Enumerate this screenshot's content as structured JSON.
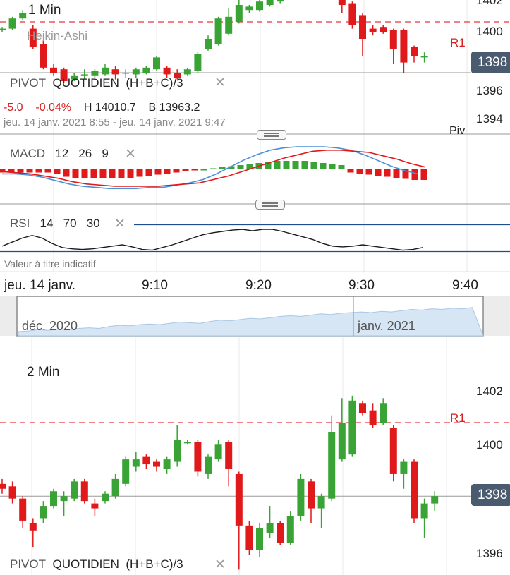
{
  "top_panel": {
    "timeframe": "1 Min",
    "chart_style": "Heikin-Ashi",
    "pivot_label": "PIVOT",
    "pivot_period": "QUOTIDIEN",
    "pivot_formula": "(H+B+C)/3",
    "change_abs": "-5.0",
    "change_pct": "-0.04%",
    "high": "H 14010.7",
    "low": "B 13963.2",
    "date_range": "jeu. 14 janv. 2021 8:55 - jeu. 14 janv. 2021 9:47",
    "r1_label": "R1",
    "pivot_line_label": "Piv",
    "price_tag": "1398",
    "y_ticks": [
      "1402",
      "1400",
      "1398",
      "1396",
      "1394"
    ]
  },
  "macd": {
    "name": "MACD",
    "fast": "12",
    "slow": "26",
    "signal": "9"
  },
  "rsi": {
    "name": "RSI",
    "period": "14",
    "upper": "70",
    "lower": "30"
  },
  "disclaimer": "Valeur à titre indicatif",
  "time_axis": {
    "date": "jeu. 14 janv.",
    "ticks": [
      "9:10",
      "9:20",
      "9:30",
      "9:40"
    ]
  },
  "navigator": {
    "labels": [
      "déc. 2020",
      "janv. 2021"
    ]
  },
  "bottom_panel": {
    "timeframe": "2 Min",
    "pivot_label": "PIVOT",
    "pivot_period": "QUOTIDIEN",
    "pivot_formula": "(H+B+C)/3",
    "r1_label": "R1",
    "price_tag": "1398",
    "y_ticks": [
      "1402",
      "1400",
      "1398",
      "1396"
    ]
  },
  "colors": {
    "up": "#3aa335",
    "down": "#e0191b",
    "r1": "#e8363a",
    "macd_line": "#4a90d9",
    "signal_line": "#e0191b",
    "rsi_line": "#1a1a1a",
    "rsi_bands": "#1f4e8c",
    "price_tag": "#4a5b70"
  },
  "chart_data": [
    {
      "type": "candlestick",
      "title": "1 Min",
      "style": "Heikin-Ashi",
      "ylim": [
        13950,
        14025
      ],
      "y_tick_labels": [
        "1402",
        "1400",
        "1398",
        "1396",
        "1394"
      ],
      "x_tick_labels": [
        "9:10",
        "9:20",
        "9:30",
        "9:40"
      ],
      "r1": 14010,
      "last_price": 13980,
      "candles": [
        {
          "o": 14005,
          "c": 14006,
          "h": 14007,
          "l": 14004
        },
        {
          "o": 14006,
          "c": 14012,
          "h": 14013,
          "l": 14005
        },
        {
          "o": 14012,
          "c": 14015,
          "h": 14017,
          "l": 14011
        },
        {
          "o": 14006,
          "c": 13995,
          "h": 14008,
          "l": 13994
        },
        {
          "o": 13997,
          "c": 13983,
          "h": 13999,
          "l": 13982
        },
        {
          "o": 13983,
          "c": 13980,
          "h": 13985,
          "l": 13978
        },
        {
          "o": 13982,
          "c": 13975,
          "h": 13983,
          "l": 13974
        },
        {
          "o": 13976,
          "c": 13978,
          "h": 13980,
          "l": 13975
        },
        {
          "o": 13978,
          "c": 13979,
          "h": 13982,
          "l": 13976
        },
        {
          "o": 13978,
          "c": 13981,
          "h": 13982,
          "l": 13977
        },
        {
          "o": 13979,
          "c": 13983,
          "h": 13985,
          "l": 13978
        },
        {
          "o": 13982,
          "c": 13979,
          "h": 13984,
          "l": 13976
        },
        {
          "o": 13980,
          "c": 13980,
          "h": 13982,
          "l": 13977
        },
        {
          "o": 13979,
          "c": 13982,
          "h": 13983,
          "l": 13977
        },
        {
          "o": 13980,
          "c": 13983,
          "h": 13984,
          "l": 13979
        },
        {
          "o": 13982,
          "c": 13989,
          "h": 13990,
          "l": 13981
        },
        {
          "o": 13983,
          "c": 13979,
          "h": 13984,
          "l": 13977
        },
        {
          "o": 13980,
          "c": 13977,
          "h": 13982,
          "l": 13976
        },
        {
          "o": 13979,
          "c": 13982,
          "h": 13983,
          "l": 13978
        },
        {
          "o": 13981,
          "c": 13991,
          "h": 13992,
          "l": 13980
        },
        {
          "o": 13994,
          "c": 14000,
          "h": 14002,
          "l": 13993
        },
        {
          "o": 13997,
          "c": 14012,
          "h": 14013,
          "l": 13996
        },
        {
          "o": 14003,
          "c": 14013,
          "h": 14018,
          "l": 14002
        },
        {
          "o": 14010,
          "c": 14020,
          "h": 14024,
          "l": 14009
        },
        {
          "o": 14017,
          "c": 14019,
          "h": 14020,
          "l": 14015
        },
        {
          "o": 14017,
          "c": 14022,
          "h": 14023,
          "l": 14016
        },
        {
          "o": 14020,
          "c": 14023,
          "h": 14026,
          "l": 14019
        },
        {
          "o": 14022,
          "c": 14028,
          "h": 14031,
          "l": 14021
        },
        {
          "o": 14026,
          "c": 14032,
          "h": 14035,
          "l": 14025
        },
        {
          "o": 14030,
          "c": 14030,
          "h": 14031,
          "l": 14028
        },
        {
          "o": 14030,
          "c": 14031,
          "h": 14032,
          "l": 14029
        },
        {
          "o": 14030,
          "c": 14030,
          "h": 14032,
          "l": 14029
        },
        {
          "o": 14030,
          "c": 14027,
          "h": 14032,
          "l": 14026
        },
        {
          "o": 14028,
          "c": 14020,
          "h": 14029,
          "l": 14015
        },
        {
          "o": 14021,
          "c": 14008,
          "h": 14022,
          "l": 14006
        },
        {
          "o": 14014,
          "c": 14000,
          "h": 14015,
          "l": 13990
        },
        {
          "o": 14006,
          "c": 14004,
          "h": 14008,
          "l": 14002
        },
        {
          "o": 14007,
          "c": 14004,
          "h": 14008,
          "l": 14003
        },
        {
          "o": 14005,
          "c": 13994,
          "h": 14006,
          "l": 13985
        },
        {
          "o": 14005,
          "c": 13986,
          "h": 14006,
          "l": 13980
        },
        {
          "o": 13995,
          "c": 13990,
          "h": 13996,
          "l": 13986
        },
        {
          "o": 13989,
          "c": 13990,
          "h": 13992,
          "l": 13986
        }
      ],
      "pivot_legend": "PIVOT QUOTIDIEN (H+B+C)/3"
    },
    {
      "type": "bar",
      "title": "MACD 12 26 9",
      "histogram": [
        -3,
        -3,
        -3,
        -3,
        -3,
        -3,
        -4,
        -7,
        -8,
        -8,
        -8,
        -8,
        -8,
        -8,
        -8,
        -7,
        -6,
        -5,
        -4,
        -3,
        -2,
        -1,
        0,
        1,
        2,
        3,
        4,
        5,
        6,
        7,
        8,
        8,
        8,
        8,
        7,
        6,
        5,
        4,
        -3,
        -4,
        -5,
        -6,
        -7,
        -8,
        -9,
        -10,
        -10,
        -10
      ],
      "macd_line": [
        -4,
        -4,
        -5,
        -7,
        -10,
        -13,
        -15,
        -16,
        -17,
        -17,
        -17,
        -16,
        -16,
        -14,
        -12,
        -9,
        -4,
        2,
        8,
        13,
        17,
        19,
        20,
        20,
        20,
        19,
        17,
        13,
        8,
        3,
        -1,
        -4
      ],
      "signal_line": [
        -2,
        -3,
        -4,
        -6,
        -8,
        -11,
        -13,
        -14,
        -15,
        -15,
        -15,
        -15,
        -14,
        -13,
        -12,
        -9,
        -6,
        -2,
        2,
        6,
        10,
        13,
        16,
        17,
        17,
        16,
        15,
        12,
        9,
        5,
        2
      ]
    },
    {
      "type": "line",
      "title": "RSI 14 70 30",
      "ylim": [
        0,
        100
      ],
      "bands": [
        70,
        30
      ],
      "values": [
        38,
        44,
        50,
        54,
        50,
        42,
        36,
        34,
        33,
        34,
        36,
        38,
        40,
        37,
        33,
        32,
        36,
        40,
        45,
        50,
        55,
        58,
        60,
        62,
        63,
        61,
        63,
        63,
        60,
        56,
        52,
        48,
        42,
        38,
        37,
        38,
        40,
        38,
        36,
        34,
        32,
        33,
        36
      ]
    },
    {
      "type": "candlestick",
      "title": "2 Min",
      "ylim": [
        13955,
        14027
      ],
      "y_tick_labels": [
        "1402",
        "1400",
        "1398",
        "1396"
      ],
      "r1": 14010,
      "last_price": 13980,
      "candles": [
        {
          "o": 13985,
          "c": 13983,
          "h": 13987,
          "l": 13981
        },
        {
          "o": 13984,
          "c": 13979,
          "h": 13986,
          "l": 13977
        },
        {
          "o": 13979,
          "c": 13970,
          "h": 13980,
          "l": 13967
        },
        {
          "o": 13969,
          "c": 13966,
          "h": 13971,
          "l": 13959
        },
        {
          "o": 13971,
          "c": 13976,
          "h": 13978,
          "l": 13969
        },
        {
          "o": 13976,
          "c": 13982,
          "h": 13983,
          "l": 13975
        },
        {
          "o": 13978,
          "c": 13980,
          "h": 13982,
          "l": 13972
        },
        {
          "o": 13979,
          "c": 13986,
          "h": 13987,
          "l": 13978
        },
        {
          "o": 13986,
          "c": 13978,
          "h": 13987,
          "l": 13977
        },
        {
          "o": 13977,
          "c": 13975,
          "h": 13979,
          "l": 13972
        },
        {
          "o": 13978,
          "c": 13981,
          "h": 13982,
          "l": 13977
        },
        {
          "o": 13980,
          "c": 13987,
          "h": 13989,
          "l": 13979
        },
        {
          "o": 13985,
          "c": 13995,
          "h": 13996,
          "l": 13984
        },
        {
          "o": 13992,
          "c": 13995,
          "h": 13998,
          "l": 13990
        },
        {
          "o": 13996,
          "c": 13993,
          "h": 13997,
          "l": 13991
        },
        {
          "o": 13994,
          "c": 13992,
          "h": 13995,
          "l": 13990
        },
        {
          "o": 13991,
          "c": 13995,
          "h": 13996,
          "l": 13989
        },
        {
          "o": 13994,
          "c": 14003,
          "h": 14009,
          "l": 13992
        },
        {
          "o": 14002,
          "c": 14002,
          "h": 14003,
          "l": 14001
        },
        {
          "o": 14002,
          "c": 13990,
          "h": 14003,
          "l": 13988
        },
        {
          "o": 13989,
          "c": 13996,
          "h": 13997,
          "l": 13987
        },
        {
          "o": 13995,
          "c": 14001,
          "h": 14003,
          "l": 13994
        },
        {
          "o": 14002,
          "c": 13991,
          "h": 14003,
          "l": 13984
        },
        {
          "o": 13989,
          "c": 13968,
          "h": 13990,
          "l": 13950
        },
        {
          "o": 13968,
          "c": 13958,
          "h": 13970,
          "l": 13956
        },
        {
          "o": 13958,
          "c": 13967,
          "h": 13969,
          "l": 13955
        },
        {
          "o": 13965,
          "c": 13969,
          "h": 13976,
          "l": 13963
        },
        {
          "o": 13969,
          "c": 13961,
          "h": 13970,
          "l": 13960
        },
        {
          "o": 13961,
          "c": 13972,
          "h": 13974,
          "l": 13960
        },
        {
          "o": 13972,
          "c": 13987,
          "h": 13989,
          "l": 13970
        },
        {
          "o": 13986,
          "c": 13975,
          "h": 13987,
          "l": 13969
        },
        {
          "o": 13975,
          "c": 13980,
          "h": 13981,
          "l": 13967
        },
        {
          "o": 13979,
          "c": 14006,
          "h": 14013,
          "l": 13978
        },
        {
          "o": 13995,
          "c": 14010,
          "h": 14020,
          "l": 13994
        },
        {
          "o": 13997,
          "c": 14019,
          "h": 14021,
          "l": 13996
        },
        {
          "o": 14018,
          "c": 14014,
          "h": 14019,
          "l": 14013
        },
        {
          "o": 14015,
          "c": 14009,
          "h": 14018,
          "l": 14008
        },
        {
          "o": 14010,
          "c": 14018,
          "h": 14020,
          "l": 14009
        },
        {
          "o": 14008,
          "c": 13989,
          "h": 14009,
          "l": 13986
        },
        {
          "o": 13989,
          "c": 13994,
          "h": 13995,
          "l": 13983
        },
        {
          "o": 13994,
          "c": 13971,
          "h": 13995,
          "l": 13969
        },
        {
          "o": 13971,
          "c": 13977,
          "h": 13979,
          "l": 13963
        },
        {
          "o": 13977,
          "c": 13980,
          "h": 13982,
          "l": 13974
        }
      ],
      "pivot_legend": "PIVOT QUOTIDIEN (H+B+C)/3"
    }
  ]
}
